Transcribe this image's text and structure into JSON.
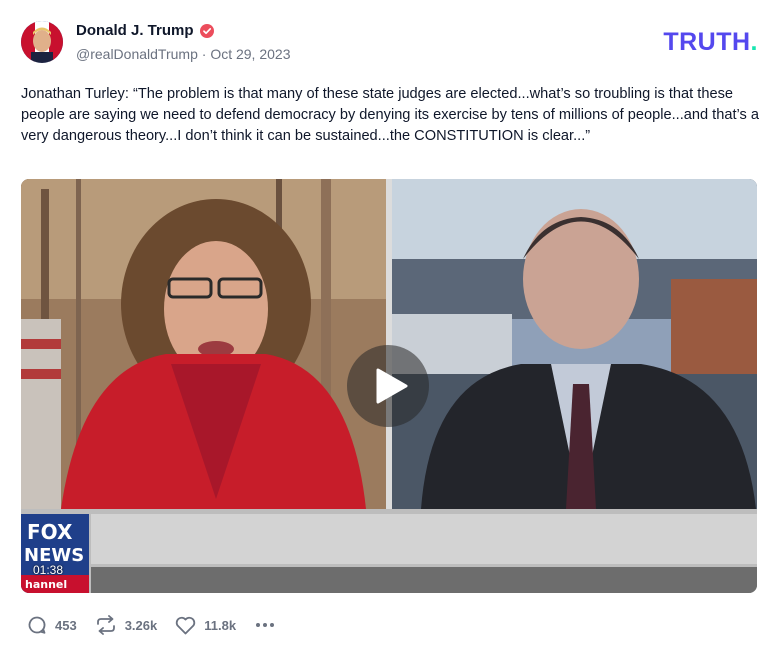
{
  "post": {
    "author_name": "Donald J. Trump",
    "handle": "@realDonaldTrump",
    "separator": "·",
    "date": "Oct 29, 2023",
    "text": "Jonathan Turley: “The problem is that many of these state judges are elected...what’s so troubling is that these people are saying we need to defend democracy by denying its exercise by tens of millions of people...and that’s a very dangerous theory...I don’t think it can be sustained...the CONSTITUTION is clear...”"
  },
  "brand": {
    "logo_text": "TRUTH",
    "logo_dot": ".",
    "logo_color": "#5448ee",
    "dot_color": "#17e6b0"
  },
  "video": {
    "duration": "01:38",
    "network_logo_lines": [
      "FOX",
      "NEWS",
      "hannel"
    ]
  },
  "actions": {
    "replies": "453",
    "retruths": "3.26k",
    "likes": "11.8k"
  },
  "colors": {
    "verified_badge": "#ec4d5c",
    "muted_text": "#6b7280"
  },
  "icons": [
    "verified-badge-icon",
    "play-icon",
    "reply-icon",
    "retruth-icon",
    "heart-icon",
    "more-icon"
  ]
}
